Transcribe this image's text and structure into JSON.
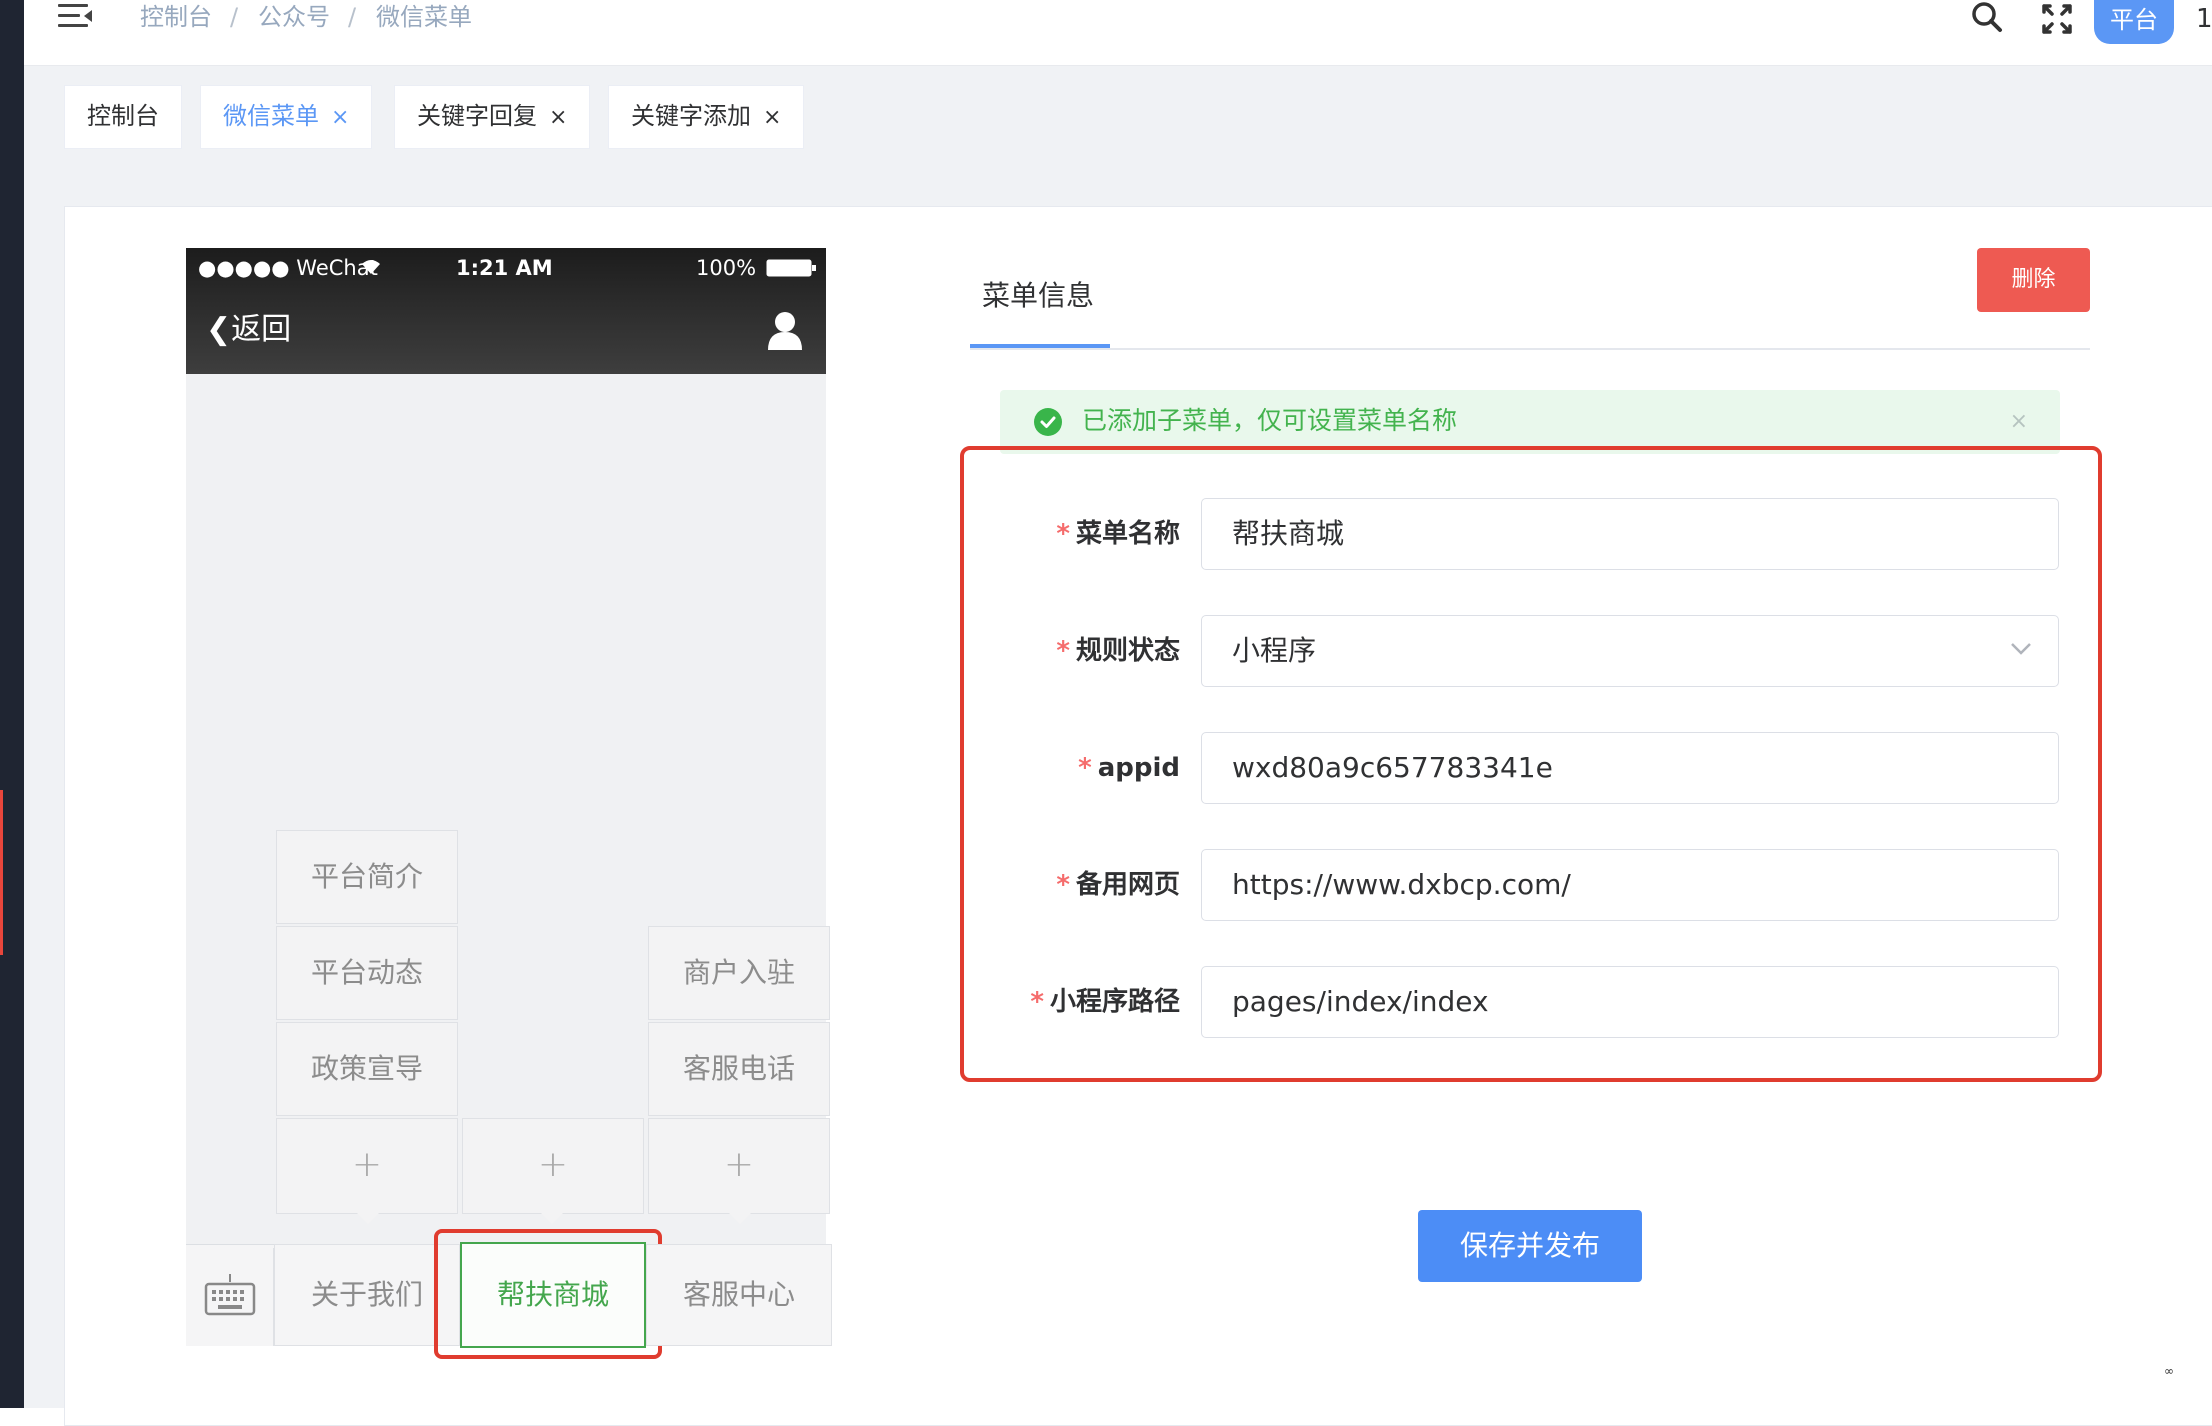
{
  "header": {
    "breadcrumb": [
      "控制台",
      "公众号",
      "微信菜单"
    ],
    "separator": "/",
    "platform_button": "平台",
    "truncated_text": "1"
  },
  "tags": [
    {
      "label": "控制台",
      "closable": false,
      "active": false
    },
    {
      "label": "微信菜单",
      "closable": true,
      "active": true
    },
    {
      "label": "关键字回复",
      "closable": true,
      "active": false
    },
    {
      "label": "关键字添加",
      "closable": true,
      "active": false
    }
  ],
  "tag_close_glyph": "×",
  "phone": {
    "carrier": "●●●●● WeChat",
    "time": "1:21 AM",
    "battery": "100%",
    "back_label": "返回",
    "menus": [
      {
        "label": "关于我们",
        "subs": [
          "平台简介",
          "平台动态",
          "政策宣导"
        ]
      },
      {
        "label": "帮扶商城",
        "subs": [],
        "selected": true
      },
      {
        "label": "客服中心",
        "subs": [
          "商户入驻",
          "客服电话"
        ]
      }
    ],
    "add_glyph": "+"
  },
  "panel": {
    "tab_label": "菜单信息",
    "delete_label": "删除",
    "alert_text": "已添加子菜单，仅可设置菜单名称",
    "alert_close": "×",
    "fields": [
      {
        "label": "菜单名称",
        "value": "帮扶商城",
        "type": "input"
      },
      {
        "label": "规则状态",
        "value": "小程序",
        "type": "select"
      },
      {
        "label": "appid",
        "value": "wxd80a9c657783341e",
        "type": "input"
      },
      {
        "label": "备用网页",
        "value": "https://www.dxbcp.com/",
        "type": "input"
      },
      {
        "label": "小程序路径",
        "value": "pages/index/index",
        "type": "input"
      }
    ],
    "required_mark": "*",
    "save_label": "保存并发布"
  },
  "colors": {
    "accent": "#5b97f5",
    "danger": "#ee5a52",
    "success": "#43b34e",
    "highlight": "#e03c2f"
  },
  "watermark": "∞"
}
